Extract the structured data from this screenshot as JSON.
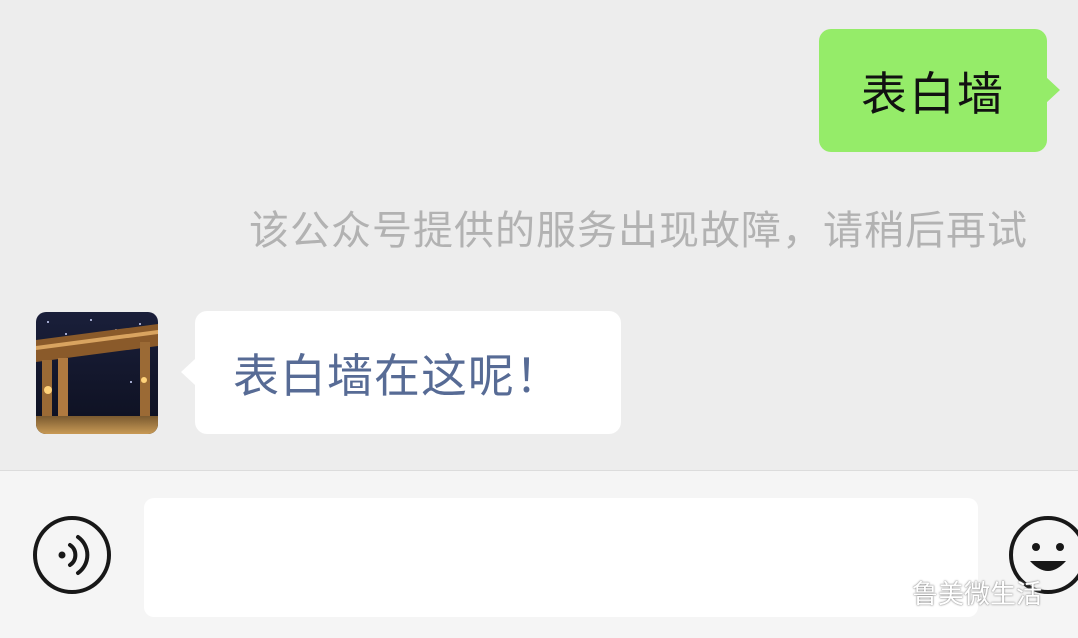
{
  "chat": {
    "outgoing_message": "表白墙",
    "system_notice": "该公众号提供的服务出现故障，请稍后再试",
    "incoming_message": "表白墙在这呢！"
  },
  "input_bar": {
    "input_value": "",
    "voice_icon": "voice-icon",
    "emoji_icon": "emoji-icon"
  },
  "watermark": {
    "text": "鲁美微生活",
    "icon": "wechat-icon"
  },
  "colors": {
    "outgoing_bubble": "#95ec69",
    "incoming_link_text": "#576b95",
    "system_text": "#b2b2b2",
    "background": "#ededed"
  }
}
